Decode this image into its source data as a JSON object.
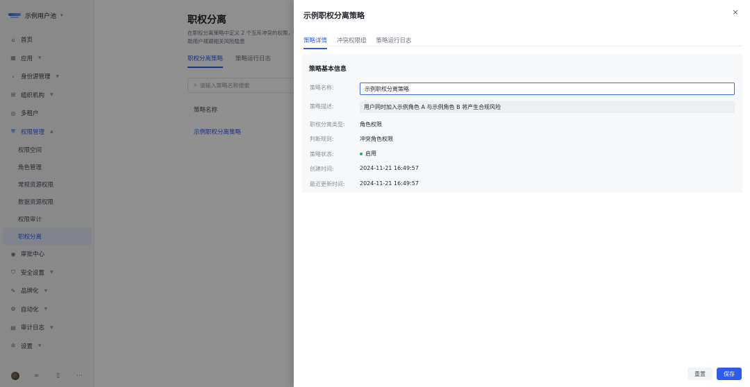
{
  "app": {
    "pool_name": "示例用户池",
    "nav": [
      {
        "icon": "home-icon",
        "label": "首页",
        "expandable": false
      },
      {
        "icon": "apps-icon",
        "label": "应用",
        "expandable": true
      },
      {
        "icon": "identity-icon",
        "label": "身份源管理",
        "expandable": true
      },
      {
        "icon": "org-icon",
        "label": "组织机构",
        "expandable": true
      },
      {
        "icon": "tenant-icon",
        "label": "多租户",
        "expandable": false
      },
      {
        "icon": "permission-icon",
        "label": "权限管理",
        "expandable": true
      }
    ],
    "permission_sub": [
      "权限空间",
      "角色管理",
      "常规资源权限",
      "数据资源权限",
      "权限审计",
      "职权分离"
    ],
    "nav_bottom": [
      {
        "icon": "approval-icon",
        "label": "审批中心",
        "expandable": false
      },
      {
        "icon": "security-icon",
        "label": "安全设置",
        "expandable": true
      },
      {
        "icon": "brand-icon",
        "label": "品牌化",
        "expandable": true
      },
      {
        "icon": "automation-icon",
        "label": "自动化",
        "expandable": true
      },
      {
        "icon": "audit-log-icon",
        "label": "审计日志",
        "expandable": true
      },
      {
        "icon": "settings-icon",
        "label": "设置",
        "expandable": true
      }
    ],
    "page": {
      "title": "职权分离",
      "description": "在职权分离策略中定义 2 个互斥冲突的权限，帮助用户规避相关风险隐患",
      "tabs": [
        "职权分离策略",
        "策略运行日志"
      ],
      "search_placeholder": "请输入策略名称搜索",
      "table_header": "策略名称",
      "table_row": "示例职权分离策略"
    }
  },
  "drawer": {
    "title": "示例职权分离策略",
    "tabs": [
      "策略详情",
      "冲突权限组",
      "策略运行日志"
    ],
    "section_title": "策略基本信息",
    "fields": {
      "name_label": "策略名称:",
      "name_value": "示例职权分离策略",
      "desc_label": "策略描述:",
      "desc_value": "用户同时加入示例角色 A 与示例角色 B 将产生合规风险",
      "type_label": "职权分离类型:",
      "type_value": "角色权限",
      "rule_label": "判断规则:",
      "rule_value": "冲突角色权限",
      "status_label": "策略状态:",
      "status_value": "启用",
      "created_label": "创建时间:",
      "created_value": "2024-11-21 16:49:57",
      "updated_label": "最近更新时间:",
      "updated_value": "2024-11-21 16:49:57"
    },
    "buttons": {
      "reset": "重置",
      "save": "保存"
    },
    "close_glyph": "×"
  },
  "colors": {
    "accent": "#2f5cf0",
    "status_enabled": "#23b26d",
    "overlay": "rgba(0,0,0,0.44)"
  }
}
